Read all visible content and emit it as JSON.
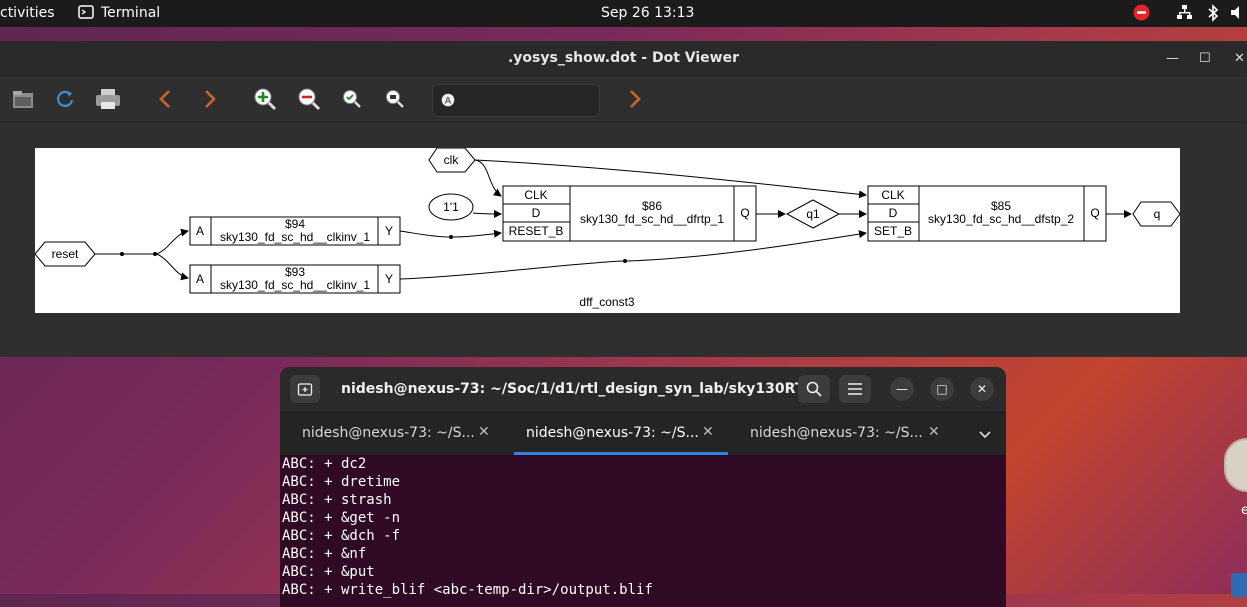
{
  "topbar": {
    "activities": "ctivities",
    "app_name": "Terminal",
    "clock": "Sep 26  13:13"
  },
  "dotviewer": {
    "title": ".yosys_show.dot - Dot Viewer",
    "search_placeholder": "",
    "toolbar_icons": [
      "open-icon",
      "reload-icon",
      "print-icon",
      "back-icon",
      "forward-icon",
      "zoom-in-icon",
      "zoom-out-icon",
      "zoom-fit-icon",
      "zoom-100-icon",
      "search-icon",
      "find-next-icon"
    ],
    "graph": {
      "module_name": "dff_const3",
      "ports": {
        "clk": "clk",
        "reset": "reset",
        "q": "q",
        "const": "1'1",
        "wire": "q1"
      },
      "cells": [
        {
          "id": "$94",
          "type": "sky130_fd_sc_hd__clkinv_1",
          "in": "A",
          "out": "Y"
        },
        {
          "id": "$93",
          "type": "sky130_fd_sc_hd__clkinv_1",
          "in": "A",
          "out": "Y"
        },
        {
          "id": "$86",
          "type": "sky130_fd_sc_hd__dfrtp_1",
          "pins": [
            "CLK",
            "D",
            "RESET_B"
          ],
          "out": "Q"
        },
        {
          "id": "$85",
          "type": "sky130_fd_sc_hd__dfstp_2",
          "pins": [
            "CLK",
            "D",
            "SET_B"
          ],
          "out": "Q"
        }
      ]
    }
  },
  "terminal": {
    "title": "nidesh@nexus-73: ~/Soc/1/d1/rtl_design_syn_lab/sky130RT...",
    "tabs": [
      {
        "label": "nidesh@nexus-73: ~/S..."
      },
      {
        "label": "nidesh@nexus-73: ~/S..."
      },
      {
        "label": "nidesh@nexus-73: ~/S..."
      }
    ],
    "lines": [
      "ABC: + dc2",
      "ABC: + dretime",
      "ABC: + strash",
      "ABC: + &get -n",
      "ABC: + &dch -f",
      "ABC: + &nf",
      "ABC: + &put",
      "ABC: + write_blif <abc-temp-dir>/output.blif"
    ]
  },
  "desktop": {
    "icon_label": "e"
  }
}
